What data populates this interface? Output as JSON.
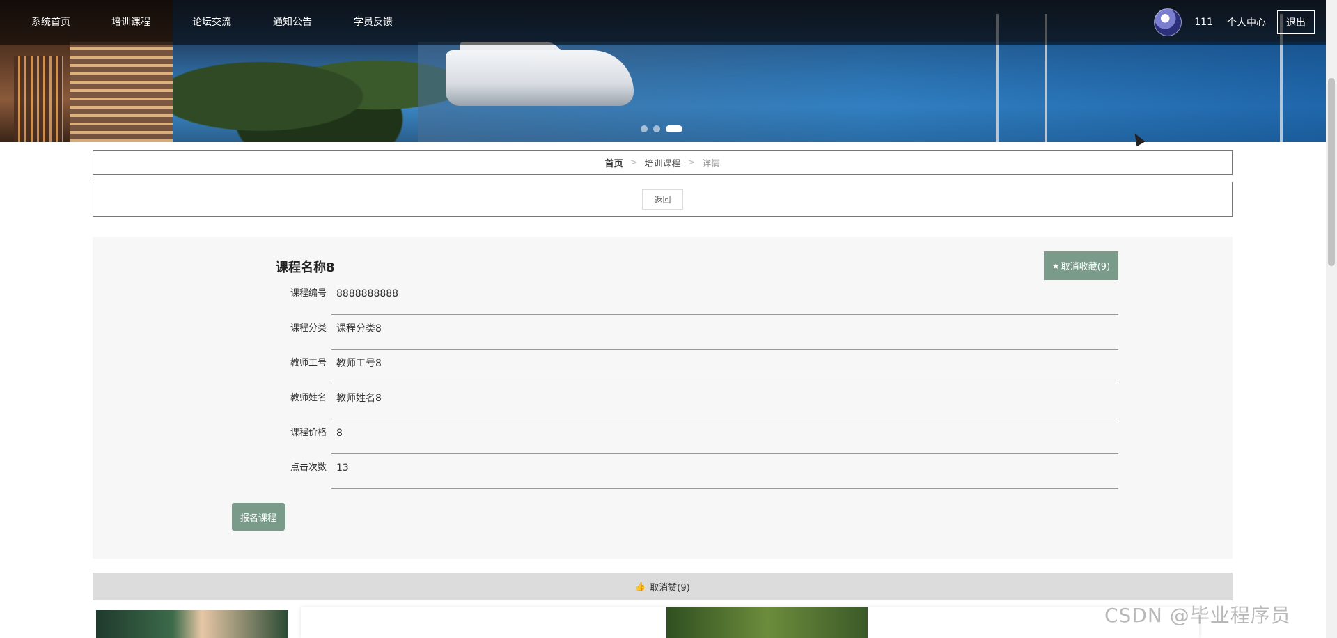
{
  "nav": {
    "items": [
      {
        "label": "系统首页"
      },
      {
        "label": "培训课程"
      },
      {
        "label": "论坛交流"
      },
      {
        "label": "通知公告"
      },
      {
        "label": "学员反馈"
      }
    ],
    "username": "111",
    "user_center": "个人中心",
    "logout": "退出"
  },
  "banner": {
    "slides_total": 3,
    "active_slide": 3
  },
  "breadcrumb": {
    "home": "首页",
    "section": "培训课程",
    "current": "详情",
    "separator": ">"
  },
  "back_label": "返回",
  "course": {
    "title": "课程名称8",
    "favorite_label": "取消收藏(9)",
    "fields": [
      {
        "label": "课程编号",
        "value": "8888888888"
      },
      {
        "label": "课程分类",
        "value": "课程分类8"
      },
      {
        "label": "教师工号",
        "value": "教师工号8"
      },
      {
        "label": "教师姓名",
        "value": "教师姓名8"
      },
      {
        "label": "课程价格",
        "value": "8"
      },
      {
        "label": "点击次数",
        "value": "13"
      }
    ],
    "enroll_label": "报名课程"
  },
  "like_label": "取消赞(9)",
  "watermark": "CSDN @毕业程序员",
  "colors": {
    "accent_green": "#7a9b8a",
    "nav_overlay": "rgba(0,0,0,0.55)",
    "like_bar": "#dcdcdc",
    "panel_bg": "#f7f7f7"
  }
}
